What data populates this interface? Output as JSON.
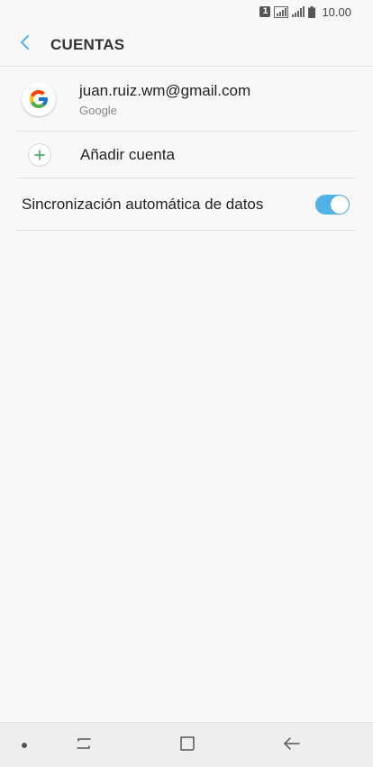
{
  "status_bar": {
    "sim": "1",
    "time": "10.00"
  },
  "header": {
    "title": "CUENTAS",
    "back_icon": "chevron-left-icon"
  },
  "accounts": [
    {
      "email": "juan.ruiz.wm@gmail.com",
      "type": "Google",
      "icon": "google-logo-icon"
    }
  ],
  "add_account": {
    "label": "Añadir cuenta",
    "icon": "plus-icon"
  },
  "sync": {
    "label": "Sincronización automática de datos",
    "enabled": true
  },
  "colors": {
    "accent": "#4fb3e8",
    "plus_green": "#3daa5a",
    "back_blue": "#4fb3e8"
  }
}
